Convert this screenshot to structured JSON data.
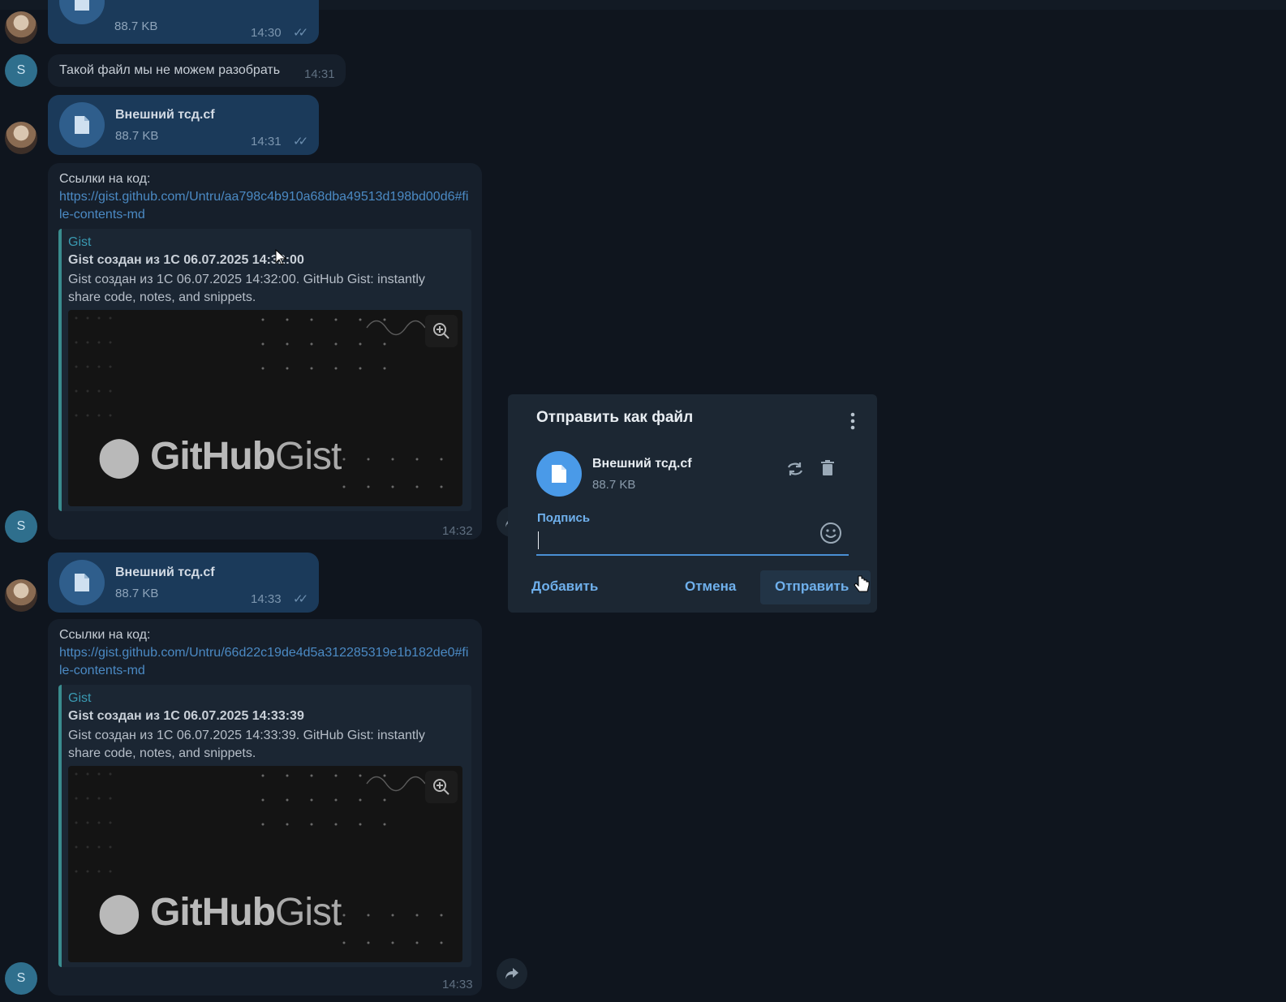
{
  "messages": [
    {
      "id": "m1",
      "size": "88.7 KB",
      "time": "14:30"
    },
    {
      "id": "m2",
      "text": "Такой файл мы не можем разобрать",
      "time": "14:31",
      "avatar_letter": "S"
    },
    {
      "id": "m3",
      "name": "Внешний тсд.cf",
      "size": "88.7 KB",
      "time": "14:31"
    },
    {
      "id": "m4",
      "heading": "Ссылки на код:",
      "link": "https://gist.github.com/Untru/aa798c4b910a68dba49513d198bd00d6#file-contents-md",
      "preview": {
        "site": "Gist",
        "title": "Gist создан из 1С 06.07.2025 14:32:00",
        "desc": "Gist создан из 1С 06.07.2025 14:32:00. GitHub Gist: instantly share code, notes, and snippets.",
        "logo_bold": "GitHub",
        "logo_light": "Gist"
      },
      "time": "14:32",
      "avatar_letter": "S"
    },
    {
      "id": "m5",
      "name": "Внешний тсд.cf",
      "size": "88.7 KB",
      "time": "14:33"
    },
    {
      "id": "m6",
      "heading": "Ссылки на код:",
      "link": "https://gist.github.com/Untru/66d22c19de4d5a312285319e1b182de0#file-contents-md",
      "preview": {
        "site": "Gist",
        "title": "Gist создан из 1С 06.07.2025 14:33:39",
        "desc": "Gist создан из 1С 06.07.2025 14:33:39. GitHub Gist: instantly share code, notes, and snippets.",
        "logo_bold": "GitHub",
        "logo_light": "Gist"
      },
      "time": "14:33",
      "avatar_letter": "S"
    }
  ],
  "dialog": {
    "title": "Отправить как файл",
    "file_name": "Внешний тсд.cf",
    "file_size": "88.7 KB",
    "caption_label": "Подпись",
    "caption_value": "",
    "add_label": "Добавить",
    "cancel_label": "Отмена",
    "send_label": "Отправить"
  },
  "icons": {
    "file": "file-icon",
    "replace": "replace-icon",
    "delete": "trash-icon",
    "emoji": "emoji-icon",
    "menu": "more-vertical-icon",
    "zoom": "zoom-in-icon",
    "forward": "forward-icon",
    "read": "double-check-icon"
  },
  "colors": {
    "accent": "#6fb0ec",
    "outgoing_bubble": "#1b3a5a",
    "incoming_bubble": "#161f2b",
    "dialog_bg": "#1c2733"
  }
}
